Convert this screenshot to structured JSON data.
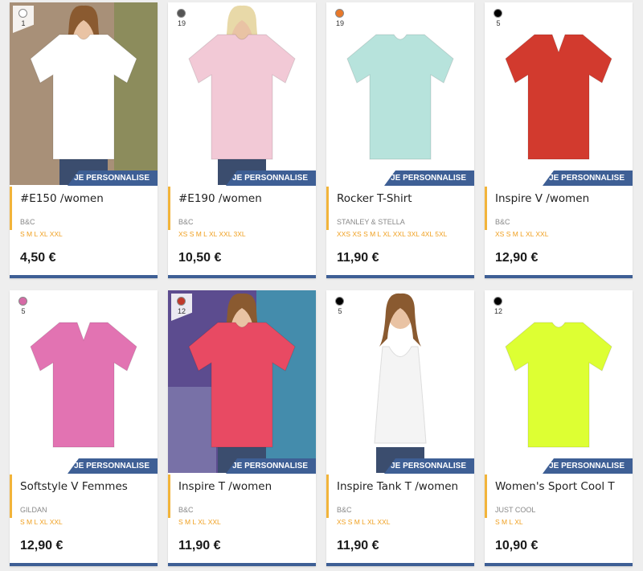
{
  "button_label": "JE PERSONNALISE",
  "products": [
    {
      "name": "#E150 /women",
      "brand": "B&C",
      "sizes": "S M L XL XXL",
      "price": "4,50 €",
      "color_count": "1",
      "swatch": "#ffffff",
      "shirt_color": "#ffffff",
      "icon": "tshirt-photo-icon"
    },
    {
      "name": "#E190 /women",
      "brand": "B&C",
      "sizes": "XS S M L XL XXL 3XL",
      "price": "10,50 €",
      "color_count": "19",
      "swatch": "#555555",
      "shirt_color": "#f2c9d6",
      "icon": "tshirt-photo-icon"
    },
    {
      "name": "Rocker T-Shirt",
      "brand": "STANLEY & STELLA",
      "sizes": "XXS XS S M L XL XXL 3XL 4XL 5XL",
      "price": "11,90 €",
      "color_count": "19",
      "swatch": "#e8782a",
      "shirt_color": "#b7e3dc",
      "icon": "tshirt-icon"
    },
    {
      "name": "Inspire V /women",
      "brand": "B&C",
      "sizes": "XS S M L XL XXL",
      "price": "12,90 €",
      "color_count": "5",
      "swatch": "#000000",
      "shirt_color": "#d23a2e",
      "icon": "vneck-tshirt-icon"
    },
    {
      "name": "Softstyle V Femmes",
      "brand": "GILDAN",
      "sizes": "S M L XL XXL",
      "price": "12,90 €",
      "color_count": "5",
      "swatch": "#d66aa6",
      "shirt_color": "#e273b2",
      "icon": "vneck-tshirt-icon"
    },
    {
      "name": "Inspire T /women",
      "brand": "B&C",
      "sizes": "S M L XL XXL",
      "price": "11,90 €",
      "color_count": "12",
      "swatch": "#c0392b",
      "shirt_color": "#e84a63",
      "icon": "tshirt-photo-icon"
    },
    {
      "name": "Inspire Tank T /women",
      "brand": "B&C",
      "sizes": "XS S M L XL XXL",
      "price": "11,90 €",
      "color_count": "5",
      "swatch": "#000000",
      "shirt_color": "#f4f4f4",
      "icon": "tank-top-photo-icon"
    },
    {
      "name": "Women's Sport Cool T",
      "brand": "JUST COOL",
      "sizes": "S M L XL",
      "price": "10,90 €",
      "color_count": "12",
      "swatch": "#000000",
      "shirt_color": "#ddff33",
      "icon": "tshirt-icon"
    }
  ]
}
